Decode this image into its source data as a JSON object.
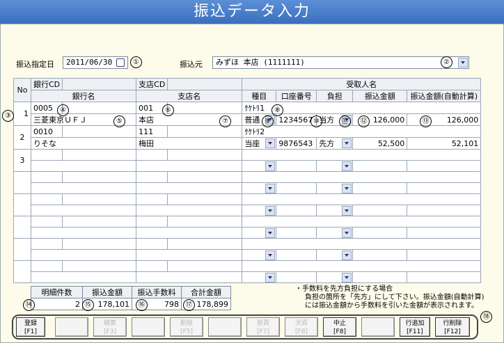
{
  "title": "振込データ入力",
  "header": {
    "date_label": "振込指定日",
    "date_value": "2011/06/30",
    "source_label": "振込元",
    "source_value": "みずほ 本店 (1111111)"
  },
  "table": {
    "no_header": "No",
    "bank_cd_header": "銀行CD",
    "bank_name_header": "銀行名",
    "branch_cd_header": "支店CD",
    "branch_name_header": "支店名",
    "payee_header": "受取人名",
    "type_header": "種目",
    "account_header": "口座番号",
    "burden_header": "負担",
    "amount_header": "振込金額",
    "amount_auto_header": "振込金額(自動計算)",
    "rows": [
      {
        "no": "1",
        "bank_cd": "0005",
        "branch_cd": "001",
        "payee": "ｹｹﾄﾘ1",
        "bank_name": "三菱東京ＵＦＪ",
        "branch_name": "本店",
        "type": "普通",
        "account": "1234567",
        "burden": "当方",
        "amount": "126,000",
        "amount_auto": "126,000"
      },
      {
        "no": "2",
        "bank_cd": "0010",
        "branch_cd": "111",
        "payee": "ｹｹﾄﾘ2",
        "bank_name": "りそな",
        "branch_name": "梅田",
        "type": "当座",
        "account": "9876543",
        "burden": "先方",
        "amount": "52,500",
        "amount_auto": "52,101"
      },
      {
        "no": "3",
        "bank_cd": "",
        "branch_cd": "",
        "payee": "",
        "bank_name": "",
        "branch_name": "",
        "type": "",
        "account": "",
        "burden": "",
        "amount": "",
        "amount_auto": ""
      }
    ]
  },
  "summary": {
    "count_label": "明細件数",
    "amount_label": "振込金額",
    "fee_label": "振込手数料",
    "total_label": "合計金額",
    "count_value": "2",
    "amount_value": "178,101",
    "fee_value": "798",
    "total_value": "178,899"
  },
  "note": {
    "line1": "・手数料を先方負担にする場合",
    "line2": "負担の箇所を「先方」にして下さい。振込金額(自動計算)",
    "line3": "には振込金額から手数料を引いた金額が表示されます。"
  },
  "fkeys": [
    {
      "label": "登録",
      "key": "[F1]",
      "enabled": true
    },
    {
      "label": "",
      "key": "",
      "enabled": false
    },
    {
      "label": "検索",
      "key": "[F3]",
      "enabled": false
    },
    {
      "label": "",
      "key": "",
      "enabled": false
    },
    {
      "label": "削除",
      "key": "[F5]",
      "enabled": false
    },
    {
      "label": "",
      "key": "",
      "enabled": false
    },
    {
      "label": "前頁",
      "key": "[F7]",
      "enabled": false
    },
    {
      "label": "次頁",
      "key": "[F8]",
      "enabled": false
    },
    {
      "label": "中止",
      "key": "[F8]",
      "enabled": true
    },
    {
      "label": "",
      "key": "",
      "enabled": false
    },
    {
      "label": "行追加",
      "key": "[F11]",
      "enabled": true
    },
    {
      "label": "行削除",
      "key": "[F12]",
      "enabled": true
    }
  ],
  "markers": [
    "①",
    "②",
    "③",
    "④",
    "⑤",
    "⑥",
    "⑦",
    "⑧",
    "⑨",
    "⑩",
    "⑪",
    "⑫",
    "⑬",
    "⑭",
    "⑮",
    "⑯",
    "⑰",
    "⑱"
  ]
}
